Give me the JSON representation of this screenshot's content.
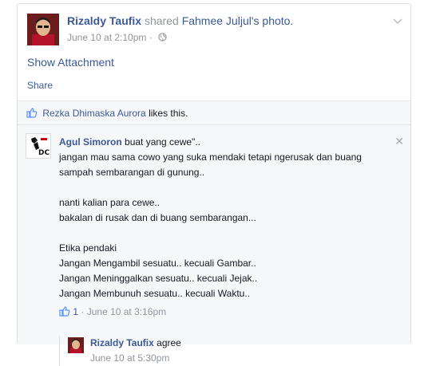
{
  "post": {
    "author": "Rizaldy Taufix",
    "action": "shared",
    "shared_owner": "Fahmee Juljul's photo.",
    "timestamp": "June 10 at 2:10pm",
    "separator": "·",
    "show_attachment": "Show Attachment",
    "share_label": "Share"
  },
  "likes": {
    "liker": "Rezka Dhimaska Aurora",
    "suffix": "likes this."
  },
  "comment": {
    "author": "Agul Simoron",
    "first_line": "buat yang cewe\"..",
    "lines": [
      "jangan mau sama cowo yang suka mendaki tetapi ngerusak dan buang",
      "sampah sembarangan di gunung..",
      "",
      "nanti kalian para cewe..",
      "bakalan di rusak dan di buang sembarangan...",
      "",
      "Etika pendaki",
      "Jangan Mengambil sesuatu.. kecuali Gambar..",
      "Jangan Meninggalkan sesuatu.. kecuali Jejak..",
      "Jangan Membunuh sesuatu.. kecuali Waktu.."
    ],
    "like_count": "1",
    "separator": "·",
    "timestamp": "June 10 at 3:16pm",
    "close_symbol": "✕"
  },
  "reply": {
    "author": "Rizaldy Taufix",
    "text": "agree",
    "timestamp": "June 10 at 5:30pm"
  },
  "colors": {
    "link": "#3b5998",
    "muted": "#90949c",
    "gray_bg": "#f6f7f9"
  }
}
